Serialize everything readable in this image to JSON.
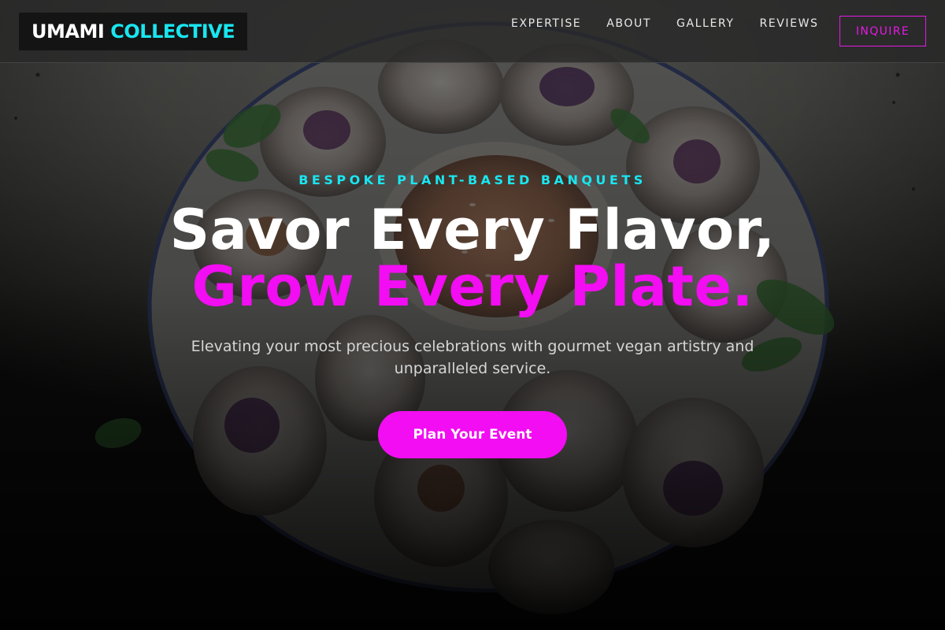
{
  "brand": {
    "name_part1": "UMAMI",
    "name_part2": "COLLECTIVE"
  },
  "nav": {
    "links": [
      "EXPERTISE",
      "ABOUT",
      "GALLERY",
      "REVIEWS"
    ],
    "cta_label": "INQUIRE"
  },
  "hero": {
    "eyebrow": "BESPOKE PLANT-BASED BANQUETS",
    "headline_line1": "Savor Every Flavor,",
    "headline_line2": "Grow Every Plate.",
    "subtitle": "Elevating your most precious celebrations with gourmet vegan artistry and unparalleled service.",
    "cta_label": "Plan Your Event",
    "background_image": "plate-of-fresh-spring-rolls-photo"
  },
  "colors": {
    "accent_cyan": "#19e6f0",
    "accent_magenta": "#f20df2",
    "nav_bg": "#282828"
  }
}
